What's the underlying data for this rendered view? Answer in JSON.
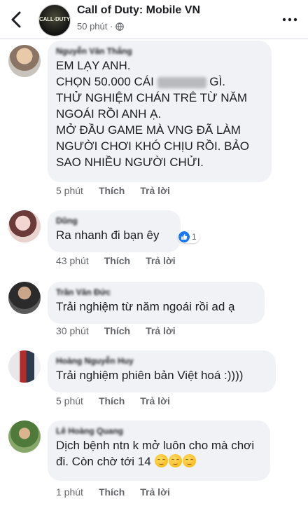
{
  "header": {
    "title": "Call of Duty: Mobile VN",
    "time": "50 phút ·",
    "avatar_text": "CALL·DUTY"
  },
  "labels": {
    "like": "Thích",
    "reply": "Trả lời"
  },
  "comments": [
    {
      "author": "Nguyễn Văn Thắng",
      "text_before_blur": "EM LẠY ANH.\nCHỌN 50.000 CÁI",
      "text_after_blur": " GÌ.\nTHỬ NGHIỆM CHÁN TRÊ TỪ NĂM NGOÁI RỒI ANH Ạ.\nMỞ ĐẦU GAME MÀ VNG ĐÃ LÀM NGƯỜI CHƠI KHÓ CHỊU RỒI. BẢO SAO NHIỀU NGƯỜI CHỬI.",
      "time": "5 phút"
    },
    {
      "author": "Dũng",
      "text": "Ra nhanh đi bạn êy",
      "time": "43 phút",
      "reaction_count": "1"
    },
    {
      "author": "Trần Văn Đức",
      "text": "Trải nghiệm từ năm ngoái rồi ad ạ",
      "time": "30 phút"
    },
    {
      "author": "Hoàng Nguyễn Huy",
      "text": "Trải nghiệm phiên bản Việt hoá :))))",
      "time": "5 phút"
    },
    {
      "author": "Lê Hoàng Quang",
      "text": "Dịch bệnh ntn k mở luôn cho mà chơi đi. Còn chờ tới 14",
      "time": "1 phút"
    }
  ],
  "colors": {
    "bubble": "#f0f2f5",
    "meta": "#65676b",
    "like_blue": "#1877f2"
  }
}
